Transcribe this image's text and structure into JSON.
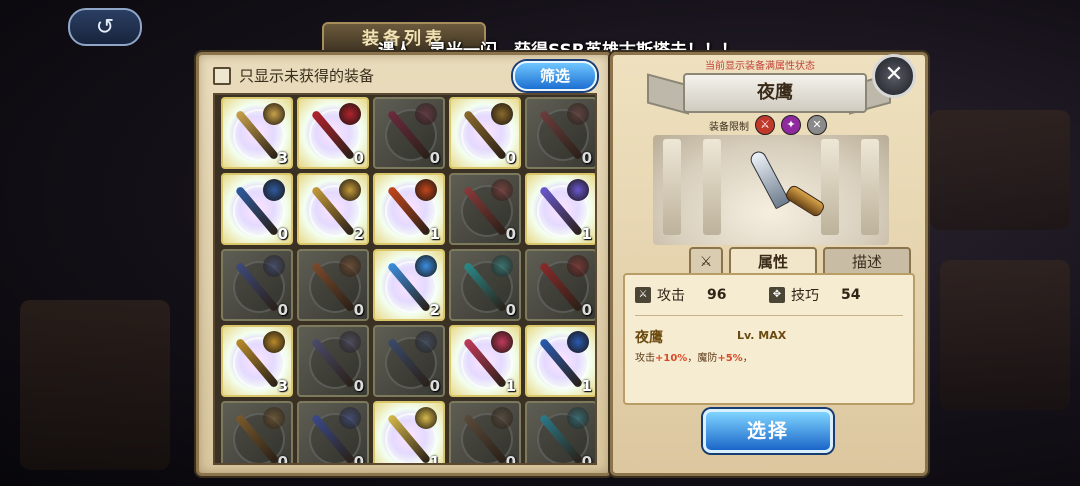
{
  "topbar": {
    "back_symbol": "↺",
    "panel_title": "装备列表",
    "announcement": "遇人，灵光一闪，获得SSR英雄古斯塔夫！！！"
  },
  "filter": {
    "only_unowned_label": "只显示未获得的装备",
    "filter_button": "筛选"
  },
  "equipment": [
    {
      "count": "3",
      "owned": true,
      "color": "#c9a24a"
    },
    {
      "count": "0",
      "owned": true,
      "color": "#b2232e"
    },
    {
      "count": "0",
      "owned": false,
      "color": "#6b2a3e"
    },
    {
      "count": "0",
      "owned": true,
      "color": "#8a6a2c"
    },
    {
      "count": "0",
      "owned": false,
      "color": "#6b3d3d"
    },
    {
      "count": "0",
      "owned": true,
      "color": "#2e5a9e"
    },
    {
      "count": "2",
      "owned": true,
      "color": "#c49a3a"
    },
    {
      "count": "1",
      "owned": true,
      "color": "#c2461c"
    },
    {
      "count": "0",
      "owned": false,
      "color": "#8a3a3a"
    },
    {
      "count": "1",
      "owned": true,
      "color": "#6a58d0"
    },
    {
      "count": "0",
      "owned": false,
      "color": "#3d4a7a"
    },
    {
      "count": "0",
      "owned": false,
      "color": "#7a4a2c"
    },
    {
      "count": "2",
      "owned": true,
      "color": "#3a8ee0"
    },
    {
      "count": "0",
      "owned": false,
      "color": "#2a8a8a"
    },
    {
      "count": "0",
      "owned": false,
      "color": "#8a2a2a"
    },
    {
      "count": "3",
      "owned": true,
      "color": "#b88a2a"
    },
    {
      "count": "0",
      "owned": false,
      "color": "#4a4a6a"
    },
    {
      "count": "0",
      "owned": false,
      "color": "#3a4a6a"
    },
    {
      "count": "1",
      "owned": true,
      "color": "#c23a5a"
    },
    {
      "count": "1",
      "owned": true,
      "color": "#2a5ab0"
    },
    {
      "count": "0",
      "owned": false,
      "color": "#7a5a2c"
    },
    {
      "count": "0",
      "owned": false,
      "color": "#3a4a8a"
    },
    {
      "count": "1",
      "owned": true,
      "color": "#d6b84a"
    },
    {
      "count": "0",
      "owned": false,
      "color": "#5a4a3a"
    },
    {
      "count": "0",
      "owned": false,
      "color": "#2a7a8a"
    }
  ],
  "detail": {
    "notice": "当前显示装备满属性状态",
    "name": "夜鹰",
    "restriction_label": "装备限制",
    "restriction_icons": [
      {
        "icon": "sword-class-icon",
        "symbol": "⚔",
        "color": "#c0392b"
      },
      {
        "icon": "magic-class-icon",
        "symbol": "✦",
        "color": "#8e2a9e"
      },
      {
        "icon": "crossed-class-icon",
        "symbol": "✕",
        "color": "#8a8a8a"
      }
    ],
    "tab_icon_symbol": "⚔",
    "tabs": [
      "属性",
      "描述"
    ],
    "stats": [
      {
        "label": "攻击",
        "value": "96",
        "symbol": "⚔"
      },
      {
        "label": "技巧",
        "value": "54",
        "symbol": "✥"
      }
    ],
    "skill": {
      "name": "夜鹰",
      "level": "Lv. MAX",
      "desc_prefix": "攻击",
      "desc_val1": "+10%",
      "desc_mid": "，魔防",
      "desc_val2": "+5%",
      "desc_suffix": "，"
    },
    "select_button": "选择",
    "close_symbol": "✕"
  }
}
